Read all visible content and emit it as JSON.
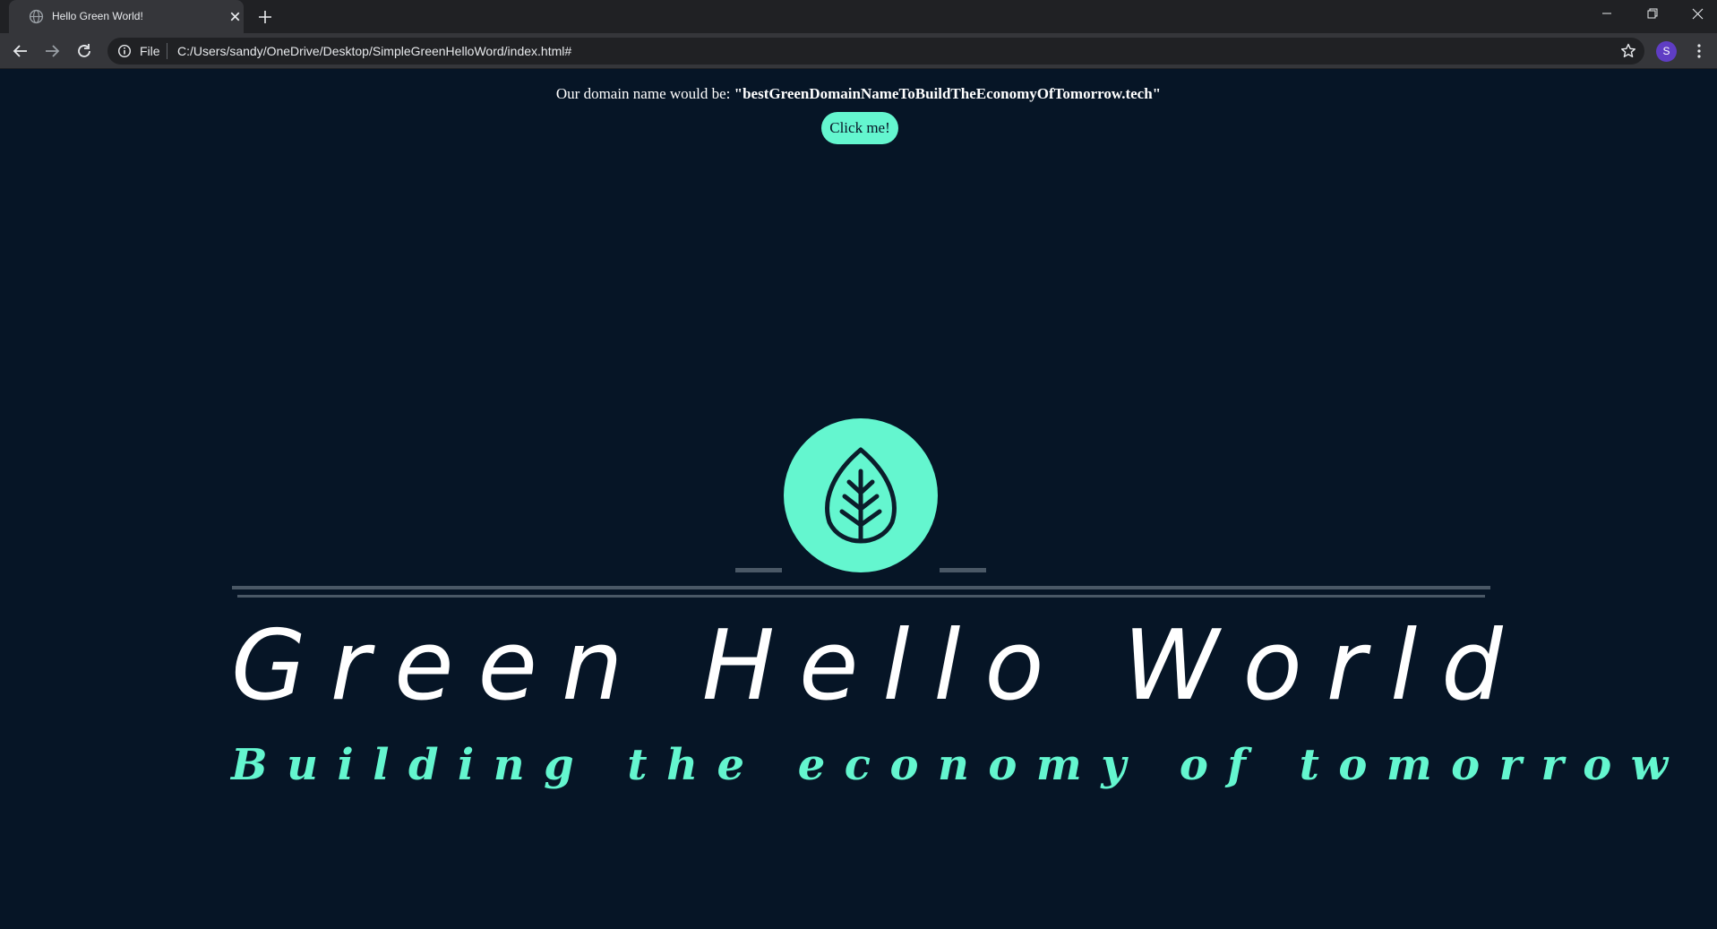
{
  "browser": {
    "tab_title": "Hello Green World!",
    "omnibox": {
      "scheme": "File",
      "url": "C:/Users/sandy/OneDrive/Desktop/SimpleGreenHelloWord/index.html#"
    },
    "profile_initial": "S",
    "colors": {
      "tabstrip": "#202124",
      "toolbar": "#35363a",
      "avatar": "#5f3dc4"
    }
  },
  "page": {
    "domain_prefix": "Our domain name would be:",
    "domain_name": "\"bestGreenDomainNameToBuildTheEconomyOfTomorrow.tech\"",
    "button_label": "Click me!",
    "logo": {
      "title": "Green Hello World",
      "tagline": "Building the economy of tomorrow",
      "icon": "leaf-icon"
    },
    "colors": {
      "background": "#061526",
      "accent": "#64f6cf",
      "text": "#ffffff"
    }
  }
}
